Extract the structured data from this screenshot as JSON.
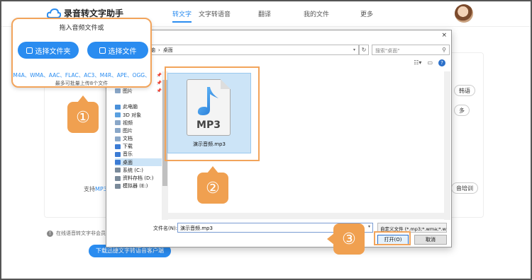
{
  "app": {
    "title": "录音转文字助手"
  },
  "nav": {
    "items": [
      {
        "label": "转文字",
        "active": true
      },
      {
        "label": "文字转语音"
      },
      {
        "label": "翻译"
      },
      {
        "label": "我的文件"
      },
      {
        "label": "更多"
      }
    ]
  },
  "upload": {
    "title": "拖入音频文件或",
    "folder_button": "选择文件夹",
    "file_button": "选择文件",
    "formats": "M4A、WMA、AAC、FLAC、AC3、M4R、APE、OGG、",
    "limit": "最多可批量上传8个文件"
  },
  "background": {
    "support_prefix": "支持",
    "support_highlight": "MP3",
    "side_btn_1": "韩语",
    "side_btn_2": "多",
    "side_btn_3": "音培训",
    "notice": "在线语音转文字非会员",
    "download_button": "下载迅捷文字转语音客户端"
  },
  "dialog": {
    "close": "×",
    "breadcrumb": [
      "此电脑",
      "桌面"
    ],
    "search_placeholder": "搜索\"桌面\"",
    "tree": [
      {
        "label": "文档",
        "icon": "doc-icon",
        "color": "#8aa7c8",
        "pinned": true
      },
      {
        "label": "下载",
        "icon": "download-icon",
        "color": "#3b7bd4",
        "pinned": true
      },
      {
        "label": "图片",
        "icon": "picture-icon",
        "color": "#8aa7c8",
        "pinned": true
      },
      {
        "label": "",
        "icon": "",
        "color": ""
      },
      {
        "label": "此电脑",
        "icon": "pc-icon",
        "color": "#4a90d9"
      },
      {
        "label": "3D 对象",
        "icon": "3d-icon",
        "color": "#5aa0e0"
      },
      {
        "label": "视频",
        "icon": "video-icon",
        "color": "#8aa7c8"
      },
      {
        "label": "图片",
        "icon": "picture-icon",
        "color": "#8aa7c8"
      },
      {
        "label": "文档",
        "icon": "doc-icon",
        "color": "#8aa7c8"
      },
      {
        "label": "下载",
        "icon": "download-icon",
        "color": "#3b7bd4"
      },
      {
        "label": "音乐",
        "icon": "music-icon",
        "color": "#3b7bd4"
      },
      {
        "label": "桌面",
        "icon": "desktop-icon",
        "color": "#3b7bd4",
        "selected": true
      },
      {
        "label": "系统 (C:)",
        "icon": "drive-icon",
        "color": "#7a8a9a"
      },
      {
        "label": "资料存档 (D:)",
        "icon": "drive-icon",
        "color": "#7a8a9a"
      },
      {
        "label": "模拟器 (E:)",
        "icon": "drive-icon",
        "color": "#7a8a9a"
      }
    ],
    "file": {
      "badge": "MP3",
      "name": "演示音频.mp3"
    },
    "filename_label": "文件名(N):",
    "filename_value": "演示音频.mp3",
    "filetype": "自定义文件 (*.mp3;*.wma;*.wav)",
    "open_button": "打开(O)",
    "cancel_button": "取消"
  },
  "markers": [
    "①",
    "②",
    "③"
  ],
  "colors": {
    "accent": "#2a8cf0",
    "callout": "#f0a050"
  }
}
